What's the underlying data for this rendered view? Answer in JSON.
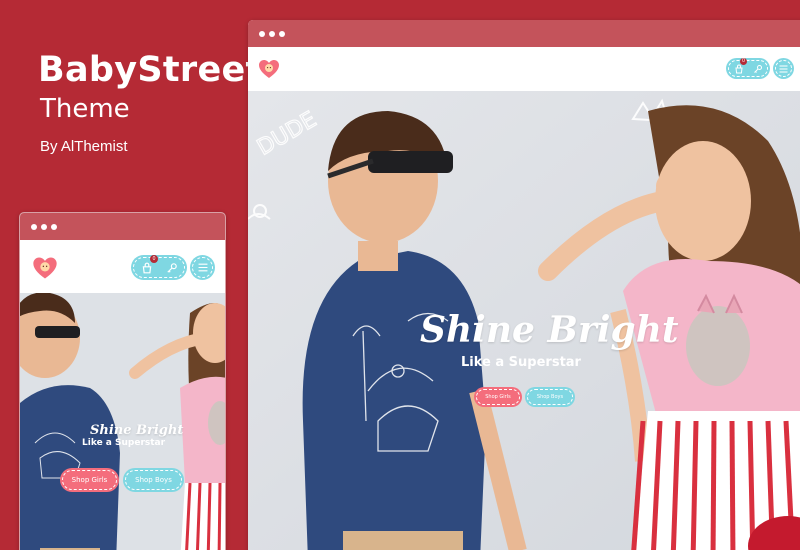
{
  "brand": {
    "title": "BabyStreet",
    "subtitle": "Theme",
    "author": "By AlThemist"
  },
  "hero": {
    "headline": "Shine Bright",
    "subline": "Like a Superstar",
    "shop_girls": "Shop Girls",
    "shop_boys": "Shop Boys",
    "doodle_text": "DUDE"
  },
  "header": {
    "cart_count": "0"
  },
  "colors": {
    "background": "#b52a35",
    "window_bar": "#c4535b",
    "accent_pink": "#f46d7c",
    "accent_cyan": "#7fd7e2"
  },
  "icons": [
    "logo-heart-icon",
    "cart-icon",
    "key-icon",
    "menu-icon"
  ]
}
